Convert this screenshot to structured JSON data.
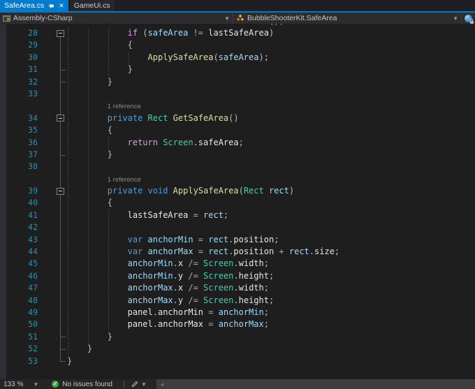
{
  "tabs": [
    {
      "label": "SafeArea.cs",
      "active": true
    },
    {
      "label": "GameUi.cs",
      "active": false
    }
  ],
  "navbar": {
    "project": "Assembly-CSharp",
    "type": "BubbleShooterKit.SafeArea"
  },
  "statusbar": {
    "zoom_level": "133 %",
    "health": "No issues found"
  },
  "colors": {
    "accent": "#007ACC",
    "editor_bg": "#1E1E1E",
    "line_number": "#2B91AF",
    "tokens": {
      "kw": "#569CD6",
      "ctrl": "#D8A0DF",
      "typ": "#4EC9B0",
      "mth": "#DCDCAA",
      "loc": "#9CDCFE",
      "fld": "#E6E6E6",
      "op": "#ABABAB",
      "pn": "#BDBDBD"
    }
  },
  "editor": {
    "top_fragment": "();",
    "lines": [
      {
        "n": 28,
        "ind": 12,
        "fold": "start-box",
        "toks": [
          [
            "ctrl",
            "if"
          ],
          [
            "pn",
            " ("
          ],
          [
            "loc",
            "safeArea"
          ],
          [
            "op",
            " != "
          ],
          [
            "fld",
            "lastSafeArea"
          ],
          [
            "pn",
            ")"
          ]
        ]
      },
      {
        "n": 29,
        "ind": 12,
        "fold": "line",
        "toks": [
          [
            "pn",
            "{"
          ]
        ]
      },
      {
        "n": 30,
        "ind": 16,
        "fold": "line",
        "toks": [
          [
            "mth",
            "ApplySafeArea"
          ],
          [
            "pn",
            "("
          ],
          [
            "loc",
            "safeArea"
          ],
          [
            "pn",
            ");"
          ]
        ]
      },
      {
        "n": 31,
        "ind": 12,
        "fold": "tick",
        "toks": [
          [
            "pn",
            "}"
          ]
        ]
      },
      {
        "n": 32,
        "ind": 8,
        "fold": "tick",
        "toks": [
          [
            "pn",
            "}"
          ]
        ]
      },
      {
        "n": 33,
        "ind": 8,
        "fold": "line",
        "toks": []
      },
      {
        "cl": "1 reference",
        "ind": 8,
        "fold": "line"
      },
      {
        "n": 34,
        "ind": 8,
        "fold": "box",
        "toks": [
          [
            "kw",
            "private "
          ],
          [
            "typ",
            "Rect "
          ],
          [
            "mth",
            "GetSafeArea"
          ],
          [
            "pn",
            "()"
          ]
        ]
      },
      {
        "n": 35,
        "ind": 8,
        "fold": "line",
        "toks": [
          [
            "pn",
            "{"
          ]
        ]
      },
      {
        "n": 36,
        "ind": 12,
        "fold": "line",
        "toks": [
          [
            "ctrl",
            "return "
          ],
          [
            "typ",
            "Screen"
          ],
          [
            "pn",
            "."
          ],
          [
            "fld",
            "safeArea"
          ],
          [
            "pn",
            ";"
          ]
        ]
      },
      {
        "n": 37,
        "ind": 8,
        "fold": "tick",
        "toks": [
          [
            "pn",
            "}"
          ]
        ]
      },
      {
        "n": 38,
        "ind": 8,
        "fold": "line",
        "toks": []
      },
      {
        "cl": "1 reference",
        "ind": 8,
        "fold": "line"
      },
      {
        "n": 39,
        "ind": 8,
        "fold": "box",
        "toks": [
          [
            "kw",
            "private "
          ],
          [
            "kw",
            "void "
          ],
          [
            "mth",
            "ApplySafeArea"
          ],
          [
            "pn",
            "("
          ],
          [
            "typ",
            "Rect"
          ],
          [
            "loc",
            " rect"
          ],
          [
            "pn",
            ")"
          ]
        ]
      },
      {
        "n": 40,
        "ind": 8,
        "fold": "line",
        "toks": [
          [
            "pn",
            "{"
          ]
        ]
      },
      {
        "n": 41,
        "ind": 12,
        "fold": "line",
        "toks": [
          [
            "fld",
            "lastSafeArea"
          ],
          [
            "op",
            " = "
          ],
          [
            "loc",
            "rect"
          ],
          [
            "pn",
            ";"
          ]
        ]
      },
      {
        "n": 42,
        "ind": 12,
        "fold": "line",
        "toks": []
      },
      {
        "n": 43,
        "ind": 12,
        "fold": "line",
        "toks": [
          [
            "kw",
            "var "
          ],
          [
            "loc",
            "anchorMin"
          ],
          [
            "op",
            " = "
          ],
          [
            "loc",
            "rect"
          ],
          [
            "pn",
            "."
          ],
          [
            "fld",
            "position"
          ],
          [
            "pn",
            ";"
          ]
        ]
      },
      {
        "n": 44,
        "ind": 12,
        "fold": "line",
        "toks": [
          [
            "kw",
            "var "
          ],
          [
            "loc",
            "anchorMax"
          ],
          [
            "op",
            " = "
          ],
          [
            "loc",
            "rect"
          ],
          [
            "pn",
            "."
          ],
          [
            "fld",
            "position"
          ],
          [
            "op",
            " + "
          ],
          [
            "loc",
            "rect"
          ],
          [
            "pn",
            "."
          ],
          [
            "fld",
            "size"
          ],
          [
            "pn",
            ";"
          ]
        ]
      },
      {
        "n": 45,
        "ind": 12,
        "fold": "line",
        "toks": [
          [
            "loc",
            "anchorMin"
          ],
          [
            "pn",
            "."
          ],
          [
            "fld",
            "x"
          ],
          [
            "op",
            " /= "
          ],
          [
            "typ",
            "Screen"
          ],
          [
            "pn",
            "."
          ],
          [
            "fld",
            "width"
          ],
          [
            "pn",
            ";"
          ]
        ]
      },
      {
        "n": 46,
        "ind": 12,
        "fold": "line",
        "toks": [
          [
            "loc",
            "anchorMin"
          ],
          [
            "pn",
            "."
          ],
          [
            "fld",
            "y"
          ],
          [
            "op",
            " /= "
          ],
          [
            "typ",
            "Screen"
          ],
          [
            "pn",
            "."
          ],
          [
            "fld",
            "height"
          ],
          [
            "pn",
            ";"
          ]
        ]
      },
      {
        "n": 47,
        "ind": 12,
        "fold": "line",
        "toks": [
          [
            "loc",
            "anchorMax"
          ],
          [
            "pn",
            "."
          ],
          [
            "fld",
            "x"
          ],
          [
            "op",
            " /= "
          ],
          [
            "typ",
            "Screen"
          ],
          [
            "pn",
            "."
          ],
          [
            "fld",
            "width"
          ],
          [
            "pn",
            ";"
          ]
        ]
      },
      {
        "n": 48,
        "ind": 12,
        "fold": "line",
        "toks": [
          [
            "loc",
            "anchorMax"
          ],
          [
            "pn",
            "."
          ],
          [
            "fld",
            "y"
          ],
          [
            "op",
            " /= "
          ],
          [
            "typ",
            "Screen"
          ],
          [
            "pn",
            "."
          ],
          [
            "fld",
            "height"
          ],
          [
            "pn",
            ";"
          ]
        ]
      },
      {
        "n": 49,
        "ind": 12,
        "fold": "line",
        "toks": [
          [
            "fld",
            "panel"
          ],
          [
            "pn",
            "."
          ],
          [
            "fld",
            "anchorMin"
          ],
          [
            "op",
            " = "
          ],
          [
            "loc",
            "anchorMin"
          ],
          [
            "pn",
            ";"
          ]
        ]
      },
      {
        "n": 50,
        "ind": 12,
        "fold": "line",
        "toks": [
          [
            "fld",
            "panel"
          ],
          [
            "pn",
            "."
          ],
          [
            "fld",
            "anchorMax"
          ],
          [
            "op",
            " = "
          ],
          [
            "loc",
            "anchorMax"
          ],
          [
            "pn",
            ";"
          ]
        ]
      },
      {
        "n": 51,
        "ind": 8,
        "fold": "tick",
        "toks": [
          [
            "pn",
            "}"
          ]
        ]
      },
      {
        "n": 52,
        "ind": 4,
        "fold": "tick",
        "toks": [
          [
            "pn",
            "}"
          ]
        ]
      },
      {
        "n": 53,
        "ind": 0,
        "fold": "end",
        "toks": [
          [
            "pn",
            "}"
          ]
        ]
      }
    ]
  }
}
